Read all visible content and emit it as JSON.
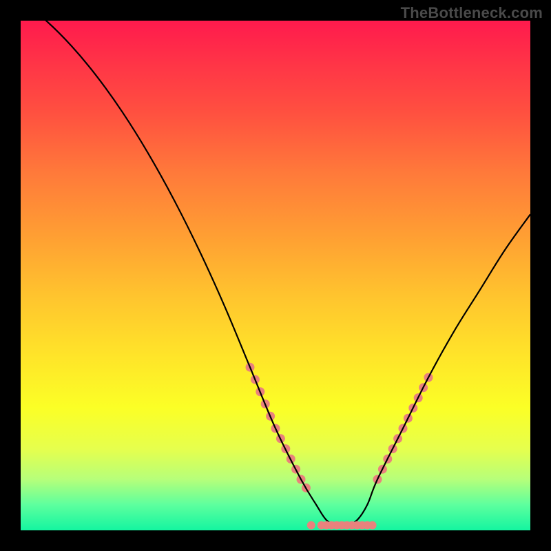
{
  "watermark": "TheBottleneck.com",
  "chart_data": {
    "type": "line",
    "title": "",
    "xlabel": "",
    "ylabel": "",
    "xlim": [
      0,
      100
    ],
    "ylim": [
      0,
      100
    ],
    "x": [
      0,
      5,
      10,
      15,
      20,
      25,
      30,
      35,
      40,
      45,
      50,
      55,
      58,
      60,
      62,
      64,
      66,
      68,
      70,
      75,
      80,
      85,
      90,
      95,
      100
    ],
    "values": [
      104,
      100,
      95,
      89,
      82,
      74,
      65,
      55,
      44,
      32,
      20,
      10,
      5,
      2,
      1,
      1,
      2,
      5,
      10,
      20,
      30,
      39,
      47,
      55,
      62
    ],
    "baseline_y": 1,
    "highlight_ranges": [
      {
        "x_start": 45,
        "x_end": 56
      },
      {
        "x_start": 70,
        "x_end": 80
      }
    ],
    "bottom_dots_x": [
      57,
      59,
      60,
      61,
      62,
      63,
      64,
      65,
      66,
      67,
      68,
      69
    ],
    "colors": {
      "curve": "#000000",
      "highlight": "#e9827d",
      "gradient_top": "#ff1a4d",
      "gradient_bottom": "#14f5a0",
      "frame": "#000000"
    }
  }
}
